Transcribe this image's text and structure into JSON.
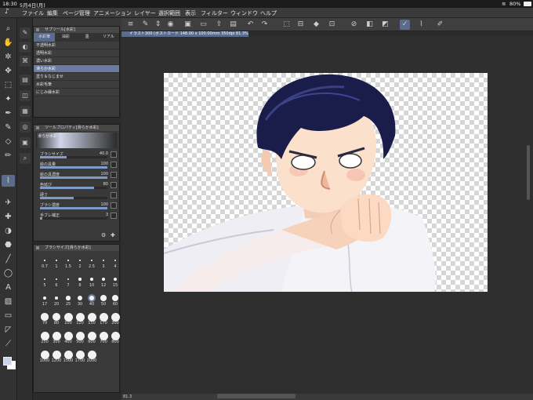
{
  "status": {
    "time": "18:30",
    "date": "5月4日(月)",
    "battery": "80%"
  },
  "menu": [
    "ファイル",
    "編集",
    "ページ管理",
    "アニメーション",
    "レイヤー",
    "選択範囲",
    "表示",
    "フィルター",
    "ウィンドウ",
    "ヘルプ"
  ],
  "subtool_panel": {
    "title": "サブツール[水彩]",
    "tabs": [
      "水彩筆",
      "油彩",
      "墨",
      "リアル"
    ],
    "items": [
      "不透明水彩",
      "透明水彩",
      "濃い水彩",
      "滑らか水彩",
      "塗り＆なじませ",
      "水彩毛筆",
      "にじみ縁水彩"
    ],
    "selected_index": 3
  },
  "tool_property": {
    "title": "ツールプロパティ[滑らか水彩]",
    "preset": "滑らか水彩",
    "rows": [
      {
        "label": "ブラシサイズ",
        "value": "40.0",
        "fraction": 0.4
      },
      {
        "label": "絵の具量",
        "value": "100",
        "fraction": 1.0
      },
      {
        "label": "絵の具濃度",
        "value": "100",
        "fraction": 1.0
      },
      {
        "label": "色延び",
        "value": "80",
        "fraction": 0.8
      },
      {
        "label": "硬さ",
        "value": "",
        "fraction": 0.5
      },
      {
        "label": "ブラシ濃度",
        "value": "100",
        "fraction": 1.0
      },
      {
        "label": "手ブレ補正",
        "value": "3",
        "fraction": 0.03
      }
    ]
  },
  "brush_size_panel": {
    "title": "ブラシサイズ[滑らか水彩]",
    "sizes": [
      "0.7",
      "1",
      "1.5",
      "2",
      "2.5",
      "3",
      "4",
      "5",
      "6",
      "7",
      "8",
      "10",
      "12",
      "15",
      "17",
      "20",
      "25",
      "30",
      "40",
      "50",
      "60",
      "70",
      "80",
      "100",
      "120",
      "150",
      "170",
      "200",
      "250",
      "300",
      "400",
      "500",
      "600",
      "700",
      "800",
      "1000",
      "1200",
      "1500",
      "1700",
      "2000"
    ],
    "selected": "40"
  },
  "document": {
    "tab": "イラスト300 (ポストカード 148.00 x 100.00mm 350dpi 81.3%)"
  },
  "bottom": {
    "zoom": "81.3"
  },
  "colors": {
    "accent": "#5a6b8c",
    "main_color": "#c9d3f0",
    "sub_color": "#ffffff"
  }
}
